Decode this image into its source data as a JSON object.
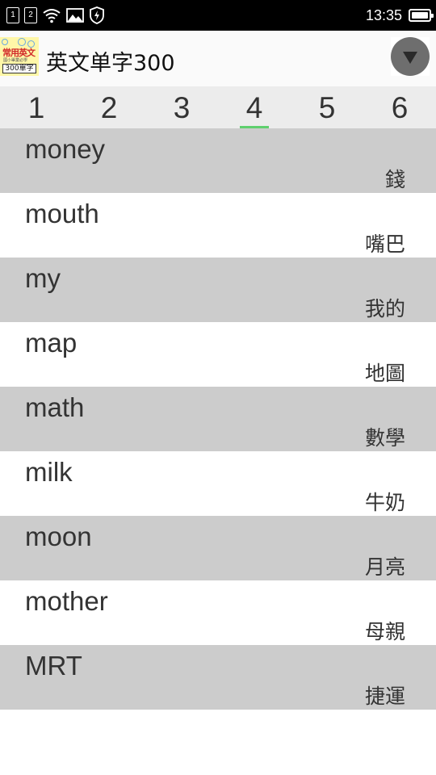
{
  "status_bar": {
    "sim1": "1",
    "sim2": "2",
    "time": "13:35"
  },
  "app_bar": {
    "title": "英文单字300",
    "logo": {
      "top": "常用英文",
      "mid": "國小畢業必學",
      "bottom": "300單字"
    }
  },
  "tabs": [
    "1",
    "2",
    "3",
    "4",
    "5",
    "6"
  ],
  "active_tab": 3,
  "words": [
    {
      "en": "money",
      "zh": "錢"
    },
    {
      "en": "mouth",
      "zh": "嘴巴"
    },
    {
      "en": "my",
      "zh": "我的"
    },
    {
      "en": "map",
      "zh": "地圖"
    },
    {
      "en": "math",
      "zh": "數學"
    },
    {
      "en": "milk",
      "zh": "牛奶"
    },
    {
      "en": "moon",
      "zh": "月亮"
    },
    {
      "en": "mother",
      "zh": "母親"
    },
    {
      "en": "MRT",
      "zh": "捷運"
    }
  ],
  "colors": {
    "active_tab_indicator": "#5fd06e",
    "alt_row": "#cccccc",
    "tab_bar": "#ececec"
  }
}
